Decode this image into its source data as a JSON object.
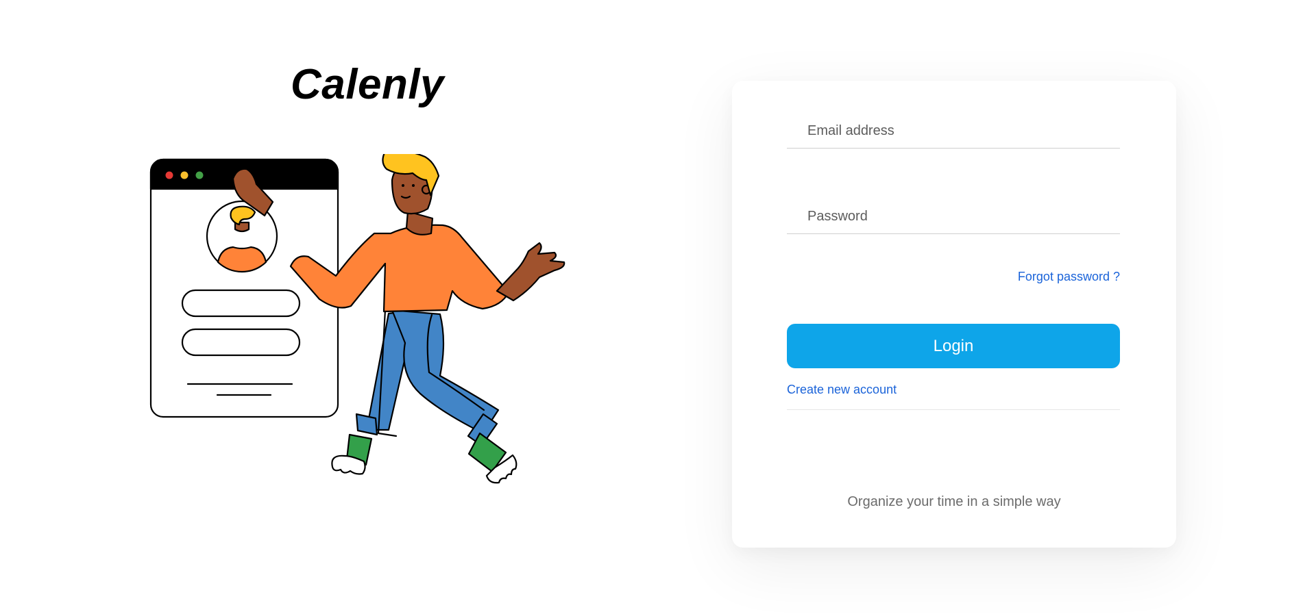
{
  "brand": {
    "name": "Calenly"
  },
  "login_form": {
    "email_placeholder": "Email address",
    "password_placeholder": "Password",
    "forgot_password_label": "Forgot password ?",
    "login_button_label": "Login",
    "create_account_label": "Create new account",
    "tagline": "Organize your time in a simple way"
  },
  "colors": {
    "primary_button": "#0ea5e9",
    "link": "#1a63d9",
    "shirt": "#ff8338",
    "pants": "#4285c7",
    "shoes": "#33a04a",
    "hair": "#ffc31f",
    "skin": "#a0522d"
  },
  "illustration": {
    "window_dots": [
      "#e53935",
      "#fbc02d",
      "#43a047"
    ]
  }
}
